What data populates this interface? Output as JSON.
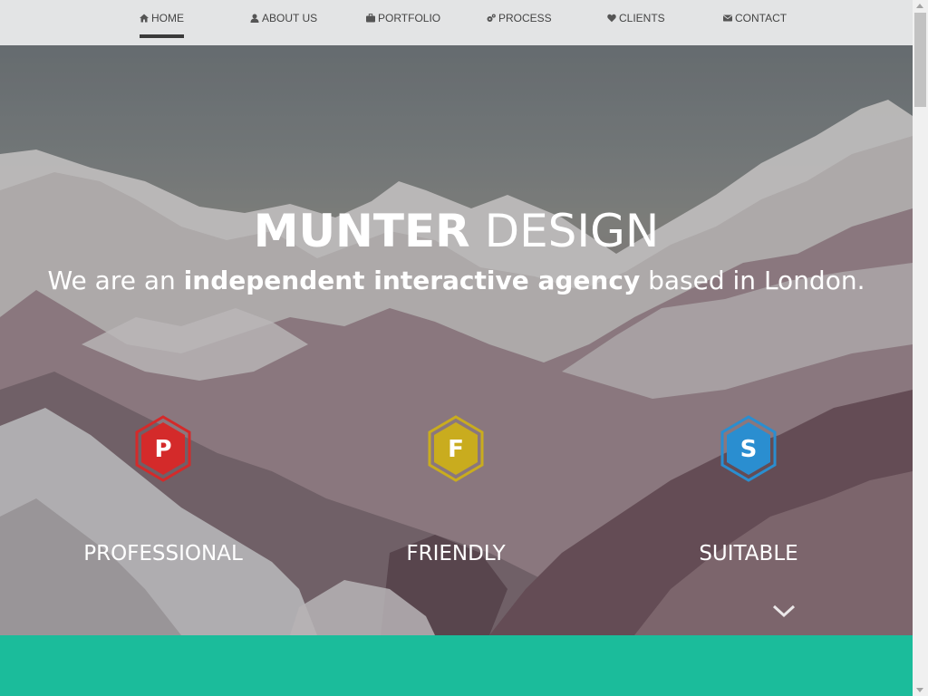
{
  "nav": {
    "items": [
      {
        "label": "HOME",
        "icon": "home-icon"
      },
      {
        "label": "ABOUT US",
        "icon": "user-icon"
      },
      {
        "label": "PORTFOLIO",
        "icon": "briefcase-icon"
      },
      {
        "label": "PROCESS",
        "icon": "gears-icon"
      },
      {
        "label": "CLIENTS",
        "icon": "heart-icon"
      },
      {
        "label": "CONTACT",
        "icon": "envelope-icon"
      }
    ],
    "active_index": 0
  },
  "hero": {
    "title_bold": "MUNTER",
    "title_light": " DESIGN",
    "subtitle_pre": "We are an ",
    "subtitle_bold": "independent interactive agency",
    "subtitle_post": " based in London.",
    "features": [
      {
        "letter": "P",
        "label": "PROFESSIONAL",
        "color": "#d42a2a"
      },
      {
        "letter": "F",
        "label": "FRIENDLY",
        "color": "#c9ac1e"
      },
      {
        "letter": "S",
        "label": "SUITABLE",
        "color": "#2a8ed0"
      }
    ],
    "scroll_down_icon": "chevron-down-icon"
  },
  "colors": {
    "teal": "#1bbc9b",
    "nav_bg": "#e3e4e5"
  }
}
